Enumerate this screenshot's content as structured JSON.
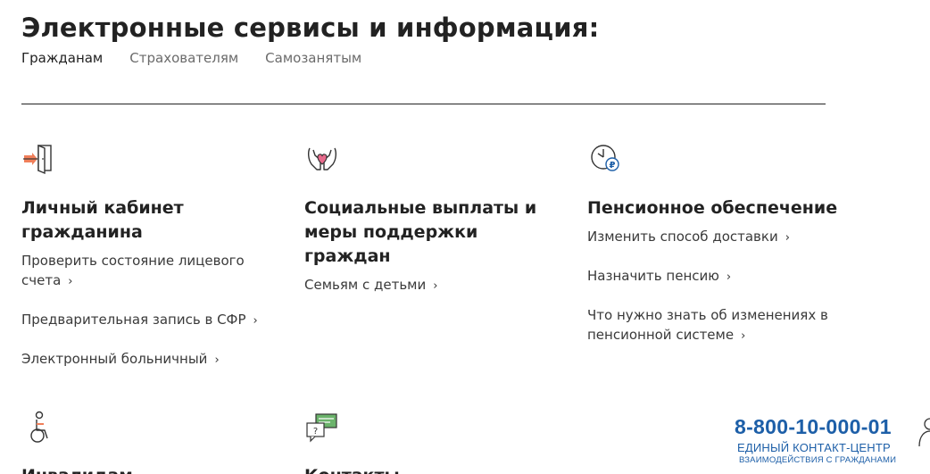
{
  "header": {
    "title": "Электронные сервисы и информация:",
    "tabs": [
      {
        "label": "Гражданам",
        "active": true
      },
      {
        "label": "Страхователям",
        "active": false
      },
      {
        "label": "Самозанятым",
        "active": false
      }
    ]
  },
  "cards": [
    {
      "icon": "door-exit-icon",
      "title": "Личный кабинет гражданина",
      "links": [
        "Проверить состояние лицевого счета",
        "Предварительная запись в СФР",
        "Электронный больничный"
      ]
    },
    {
      "icon": "hands-heart-icon",
      "title": "Социальные выплаты и меры поддержки граждан",
      "links": [
        "Семьям с детьми"
      ]
    },
    {
      "icon": "clock-ruble-icon",
      "title": "Пенсионное обеспечение",
      "links": [
        "Изменить способ доставки",
        "Назначить пенсию",
        "Что нужно знать об изменениях в пенсионной системе"
      ]
    },
    {
      "icon": "wheelchair-icon",
      "title": "Инвалидам",
      "links": []
    },
    {
      "icon": "chat-question-icon",
      "title": "Контакты",
      "links": []
    }
  ],
  "contact": {
    "phone": "8-800-10-000-01",
    "line1": "ЕДИНЫЙ КОНТАКТ-ЦЕНТР",
    "line2": "ВЗАИМОДЕЙСТВИЯ С ГРАЖДАНАМИ"
  },
  "colors": {
    "accent_orange": "#f07f5a",
    "accent_pink": "#e86a8c",
    "accent_blue": "#1d5fa8",
    "text": "#222222"
  }
}
